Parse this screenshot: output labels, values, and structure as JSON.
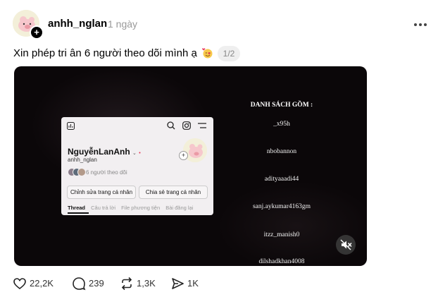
{
  "post": {
    "username": "anhh_nglan",
    "time": "1 ngày",
    "text": "Xin phép tri ân 6 người theo dõi mình ạ",
    "page_indicator": "1/2"
  },
  "media": {
    "profile_card": {
      "name": "NguyễnLanAnh",
      "handle": "anhh_nglan",
      "followers": "6 người theo dõi",
      "edit_button": "Chỉnh sửa trang cá nhân",
      "share_button": "Chia sẻ trang cá nhân",
      "tabs": [
        "Thread",
        "Câu trả lời",
        "File phương tiện",
        "Bài đăng lại"
      ]
    },
    "list_title": "DANH SÁCH GỒM :",
    "list_items": [
      "_x95h",
      "nbobannon",
      "adityaaadi44",
      "sanj.aykumar4163gm",
      "itzz_manish0",
      "dilshadkhan4008"
    ]
  },
  "actions": {
    "likes": "22,2K",
    "replies": "239",
    "reposts": "1,3K",
    "shares": "1K"
  },
  "icons": {
    "avatar": "pig-avatar-icon",
    "follow": "plus-icon",
    "more": "more-horizontal-icon",
    "emoji": "smiling-face-with-hearts-icon",
    "mute": "volume-muted-icon",
    "like": "heart-icon",
    "reply": "comment-icon",
    "repost": "repost-icon",
    "share": "send-icon"
  }
}
